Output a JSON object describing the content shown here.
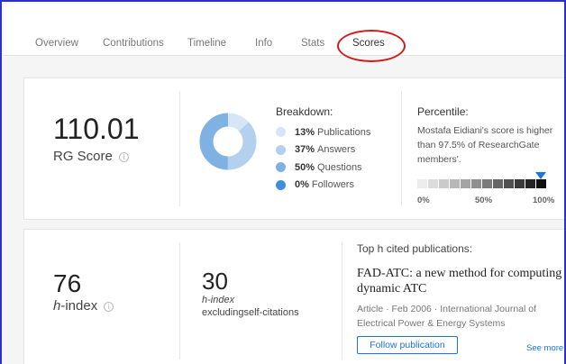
{
  "tabs": [
    {
      "label": "Overview"
    },
    {
      "label": "Contributions"
    },
    {
      "label": "Timeline"
    },
    {
      "label": "Info"
    },
    {
      "label": "Stats"
    },
    {
      "label": "Scores",
      "active": true
    }
  ],
  "rg_score": {
    "value": "110.01",
    "label": "RG Score",
    "info_icon": "info-icon"
  },
  "breakdown": {
    "title": "Breakdown:",
    "items": [
      {
        "percent": "13%",
        "label": "Publications",
        "value": 13,
        "color": "#d6e6f7"
      },
      {
        "percent": "37%",
        "label": "Answers",
        "value": 37,
        "color": "#b3d1ee"
      },
      {
        "percent": "50%",
        "label": "Questions",
        "value": 50,
        "color": "#7fb2e3"
      },
      {
        "percent": "0%",
        "label": "Followers",
        "value": 0,
        "color": "#3d8fdb"
      }
    ]
  },
  "percentile": {
    "title": "Percentile:",
    "text": "Mostafa Eidiani's score is higher than 97.5% of ResearchGate members'.",
    "value": 97.5,
    "axis_labels": [
      "0%",
      "50%",
      "100%"
    ],
    "marker_color": "#1a73e8"
  },
  "h_index": {
    "value": "76",
    "label_italic": "h",
    "label_rest": "-index",
    "info_icon": "info-icon"
  },
  "h_index_excl": {
    "value": "30",
    "line1": "h-index",
    "line2": "excludingself-citations"
  },
  "top_cited": {
    "title": "Top h cited publications:",
    "publication_title": "FAD-ATC: a new method for computing dynamic ATC",
    "meta": "Article · Feb 2006 · International Journal of Electrical Power & Energy Systems",
    "follow_label": "Follow publication",
    "see_more": "See more"
  },
  "colors": {
    "accent": "#1a73e8",
    "frame_border": "#2a32c9",
    "highlight": "#d11a1a"
  }
}
